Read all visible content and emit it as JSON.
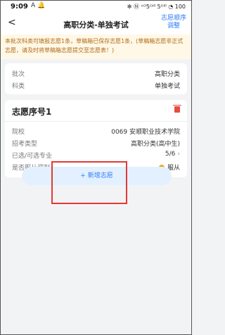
{
  "status": {
    "time": "9:09",
    "icons_left": "A 🔔",
    "icons_right": "✻ Ⓝ ᵛᴼ5ᴳᴵˡˡ 5ᴳᴵˡˡ ◔ 100"
  },
  "header": {
    "back": "<",
    "title": "高职分类-单独考试",
    "adjust_label": "志愿顺序调整"
  },
  "notice": "本批次科类可填报志愿1条，草稿箱已保存志愿1条，(草稿箱志愿非正式志愿，请及时将草稿箱志愿提交至志愿表！)",
  "batch_card": {
    "batch_label": "批次",
    "batch_value": "高职分类",
    "subject_label": "科类",
    "subject_value": "单独考试"
  },
  "wish_card": {
    "title": "志愿序号1",
    "school_label": "院校",
    "school_value": "0069 安顺职业技术学院",
    "type_label": "招考类型",
    "type_value": "高职分类(高中生)",
    "major_label": "已选/可选专业",
    "major_value": "5/6",
    "adjust_label": "是否服从调剂",
    "adjust_value": "服从"
  },
  "add_button": "+ 新增志愿",
  "colors": {
    "accent": "#2f7cf6",
    "danger": "#e74c3c",
    "notice_text": "#b06a1a",
    "highlight": "#e53935"
  }
}
